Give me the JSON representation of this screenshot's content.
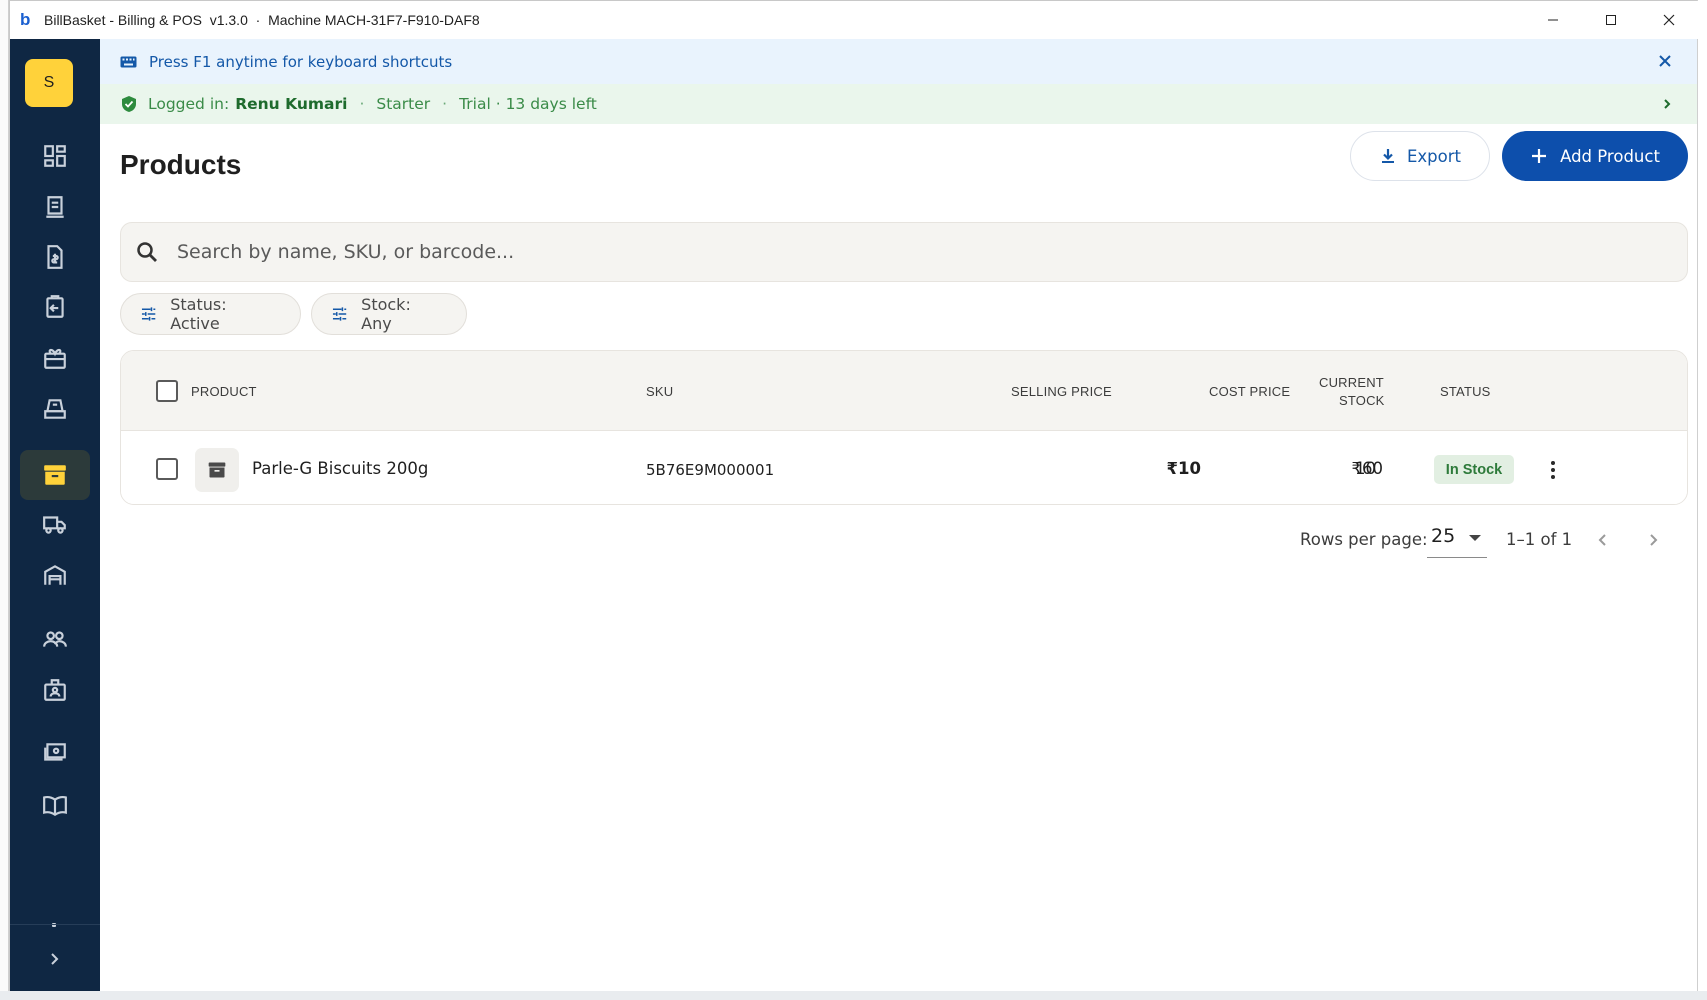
{
  "window": {
    "title": "BillBasket - Billing & POS  v1.3.0  ·  Machine MACH-31F7-F910-DAF8",
    "logo_letter": "b"
  },
  "sidebar": {
    "avatar_letter": "S",
    "items": [
      {
        "name": "dashboard-icon",
        "active": false
      },
      {
        "name": "receipt-icon",
        "active": false
      },
      {
        "name": "invoice-icon",
        "active": false
      },
      {
        "name": "returns-icon",
        "active": false
      },
      {
        "name": "offers-icon",
        "active": false
      },
      {
        "name": "pos-icon",
        "active": false
      },
      {
        "name": "products-icon",
        "active": true
      },
      {
        "name": "delivery-icon",
        "active": false
      },
      {
        "name": "warehouse-icon",
        "active": false
      },
      {
        "name": "customers-icon",
        "active": false
      },
      {
        "name": "staff-icon",
        "active": false
      },
      {
        "name": "cash-icon",
        "active": false
      },
      {
        "name": "ledger-icon",
        "active": false
      }
    ]
  },
  "banner_info": {
    "text": "Press F1 anytime for keyboard shortcuts"
  },
  "banner_login": {
    "label": "Logged in:",
    "user": "Renu Kumari",
    "plan": "Starter",
    "trial": "Trial · 13 days left",
    "separator": "·"
  },
  "page": {
    "title": "Products",
    "export_label": "Export",
    "add_label": "Add Product"
  },
  "search": {
    "placeholder": "Search by name, SKU, or barcode..."
  },
  "filters": [
    {
      "label": "Status: Active"
    },
    {
      "label": "Stock: Any"
    }
  ],
  "table": {
    "columns": {
      "product": "PRODUCT",
      "sku": "SKU",
      "selling_price": "SELLING PRICE",
      "cost_price": "COST PRICE",
      "current_stock_1": "CURRENT",
      "current_stock_2": "STOCK",
      "status": "STATUS"
    },
    "rows": [
      {
        "product": "Parle-G Biscuits 200g",
        "sku": "5B76E9M000001",
        "selling_price": "₹10",
        "cost_price": "₹60",
        "current_stock": "10",
        "status": "In Stock"
      }
    ]
  },
  "pagination": {
    "rows_per_page_label": "Rows per page:",
    "rows_per_page": "25",
    "range": "1–1 of 1"
  },
  "colors": {
    "sidebar_bg": "#0f2743",
    "accent": "#0d4fac",
    "avatar": "#ffd23a",
    "info_banner": "#e9f3fd",
    "login_banner": "#eaf6ec",
    "status_badge_bg": "#e2efe2",
    "status_badge_text": "#2d7a3a"
  }
}
